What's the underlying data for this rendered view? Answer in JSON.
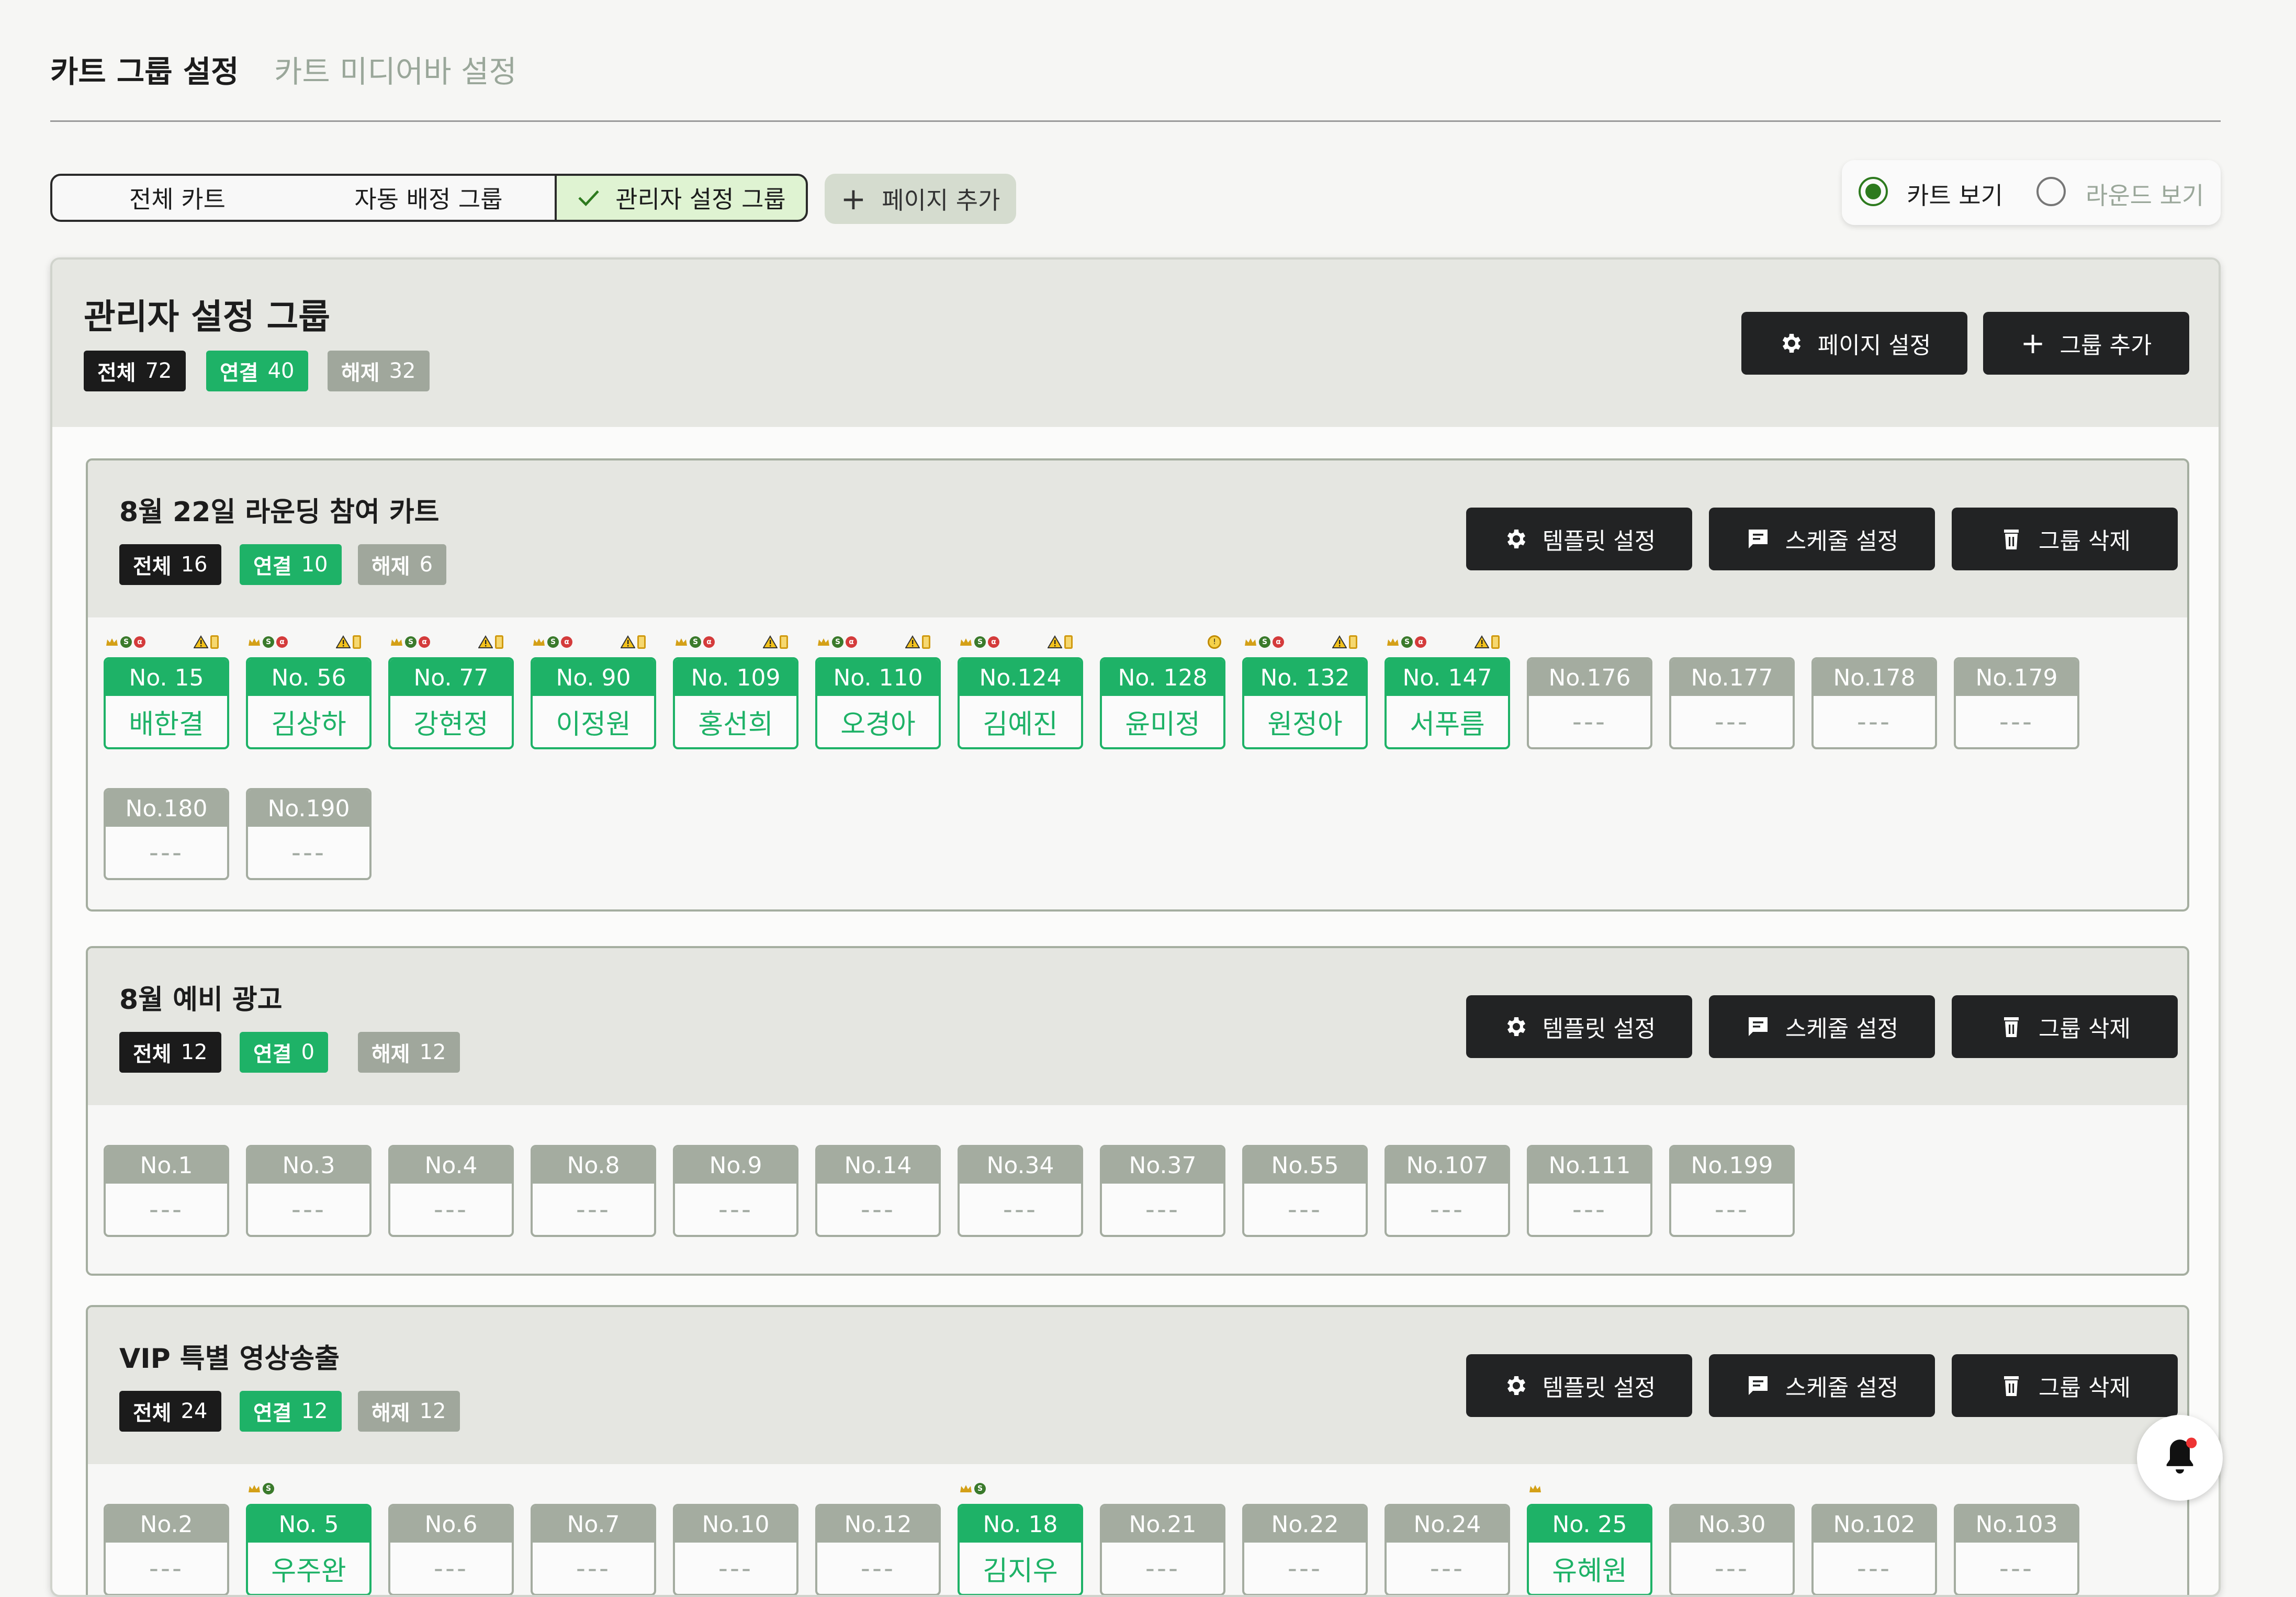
{
  "top_tabs": [
    "카트 그룹 설정",
    "카트 미디어바 설정"
  ],
  "segments": [
    "전체 카트",
    "자동 배정 그룹",
    "관리자 설정 그룹"
  ],
  "add_page_label": "페이지 추가",
  "view_toggle": {
    "cart_view": "카트 보기",
    "round_view": "라운드 보기",
    "selected": "카트 보기"
  },
  "panel": {
    "title": "관리자 설정 그룹",
    "badges": {
      "all_label": "전체",
      "all": "72",
      "on_label": "연결",
      "on": "40",
      "off_label": "해제",
      "off": "32"
    },
    "page_settings": "페이지 설정",
    "add_group": "그룹 추가"
  },
  "group_buttons": {
    "template": "템플릿 설정",
    "schedule": "스케줄 설정",
    "delete": "그룹 삭제"
  },
  "empty_name": "---",
  "groups": [
    {
      "title": "8월 22일 라운딩 참여 카트",
      "badges": {
        "all": "16",
        "on": "10",
        "off": "6"
      },
      "carts": [
        {
          "no": "No. 15",
          "name": "배한결",
          "on": true
        },
        {
          "no": "No. 56",
          "name": "김상하",
          "on": true
        },
        {
          "no": "No. 77",
          "name": "강현정",
          "on": true
        },
        {
          "no": "No. 90",
          "name": "이정원",
          "on": true
        },
        {
          "no": "No. 109",
          "name": "홍선희",
          "on": true
        },
        {
          "no": "No. 110",
          "name": "오경아",
          "on": true
        },
        {
          "no": "No.124",
          "name": "김예진",
          "on": true
        },
        {
          "no": "No. 128",
          "name": "윤미정",
          "on": true
        },
        {
          "no": "No. 132",
          "name": "원정아",
          "on": true
        },
        {
          "no": "No. 147",
          "name": "서푸름",
          "on": true
        },
        {
          "no": "No.176",
          "name": "",
          "on": false
        },
        {
          "no": "No.177",
          "name": "",
          "on": false
        },
        {
          "no": "No.178",
          "name": "",
          "on": false
        },
        {
          "no": "No.179",
          "name": "",
          "on": false
        },
        {
          "no": "No.180",
          "name": "",
          "on": false
        },
        {
          "no": "No.190",
          "name": "",
          "on": false
        }
      ]
    },
    {
      "title": "8월 예비 광고",
      "badges": {
        "all": "12",
        "on": "0",
        "off": "12"
      },
      "carts": [
        {
          "no": "No.1",
          "name": "",
          "on": false
        },
        {
          "no": "No.3",
          "name": "",
          "on": false
        },
        {
          "no": "No.4",
          "name": "",
          "on": false
        },
        {
          "no": "No.8",
          "name": "",
          "on": false
        },
        {
          "no": "No.9",
          "name": "",
          "on": false
        },
        {
          "no": "No.14",
          "name": "",
          "on": false
        },
        {
          "no": "No.34",
          "name": "",
          "on": false
        },
        {
          "no": "No.37",
          "name": "",
          "on": false
        },
        {
          "no": "No.55",
          "name": "",
          "on": false
        },
        {
          "no": "No.107",
          "name": "",
          "on": false
        },
        {
          "no": "No.111",
          "name": "",
          "on": false
        },
        {
          "no": "No.199",
          "name": "",
          "on": false
        }
      ]
    },
    {
      "title": "VIP 특별 영상송출",
      "badges": {
        "all": "24",
        "on": "12",
        "off": "12"
      },
      "carts": [
        {
          "no": "No.2",
          "name": "",
          "on": false
        },
        {
          "no": "No. 5",
          "name": "우주완",
          "on": true
        },
        {
          "no": "No.6",
          "name": "",
          "on": false
        },
        {
          "no": "No.7",
          "name": "",
          "on": false
        },
        {
          "no": "No.10",
          "name": "",
          "on": false
        },
        {
          "no": "No.12",
          "name": "",
          "on": false
        },
        {
          "no": "No. 18",
          "name": "김지우",
          "on": true
        },
        {
          "no": "No.21",
          "name": "",
          "on": false
        },
        {
          "no": "No.22",
          "name": "",
          "on": false
        },
        {
          "no": "No.24",
          "name": "",
          "on": false
        },
        {
          "no": "No. 25",
          "name": "유혜원",
          "on": true
        },
        {
          "no": "No.30",
          "name": "",
          "on": false
        },
        {
          "no": "No.102",
          "name": "",
          "on": false
        },
        {
          "no": "No.103",
          "name": "",
          "on": false
        }
      ]
    }
  ],
  "colors": {
    "connected": "#1eb267",
    "disconnected": "#a4aca0",
    "dark": "#222324",
    "accent_radio": "#2d7a1e"
  }
}
